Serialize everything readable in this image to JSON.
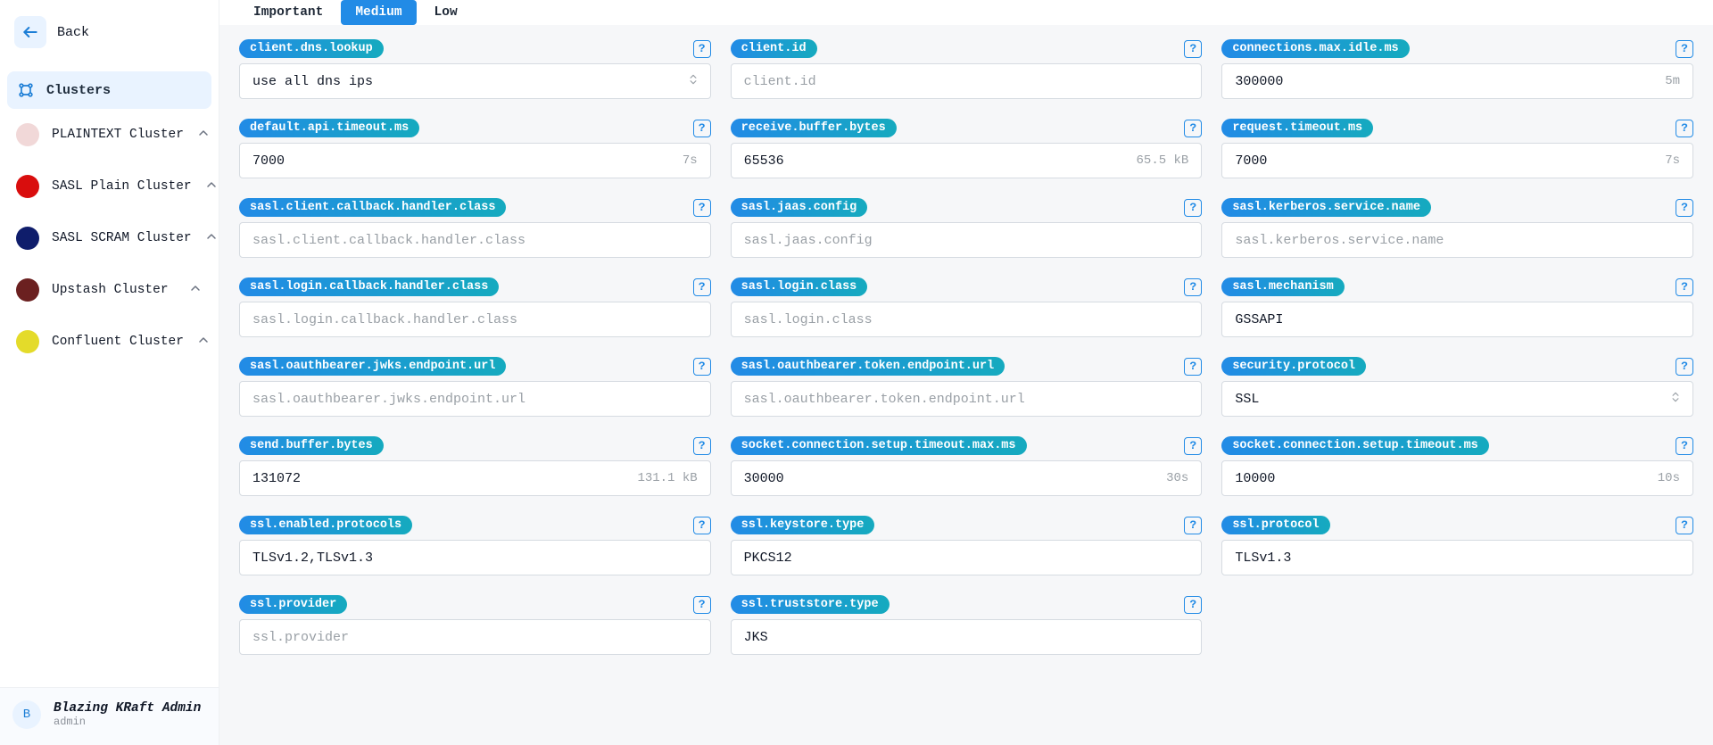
{
  "sidebar": {
    "back_label": "Back",
    "nav_section_label": "Clusters",
    "clusters": [
      {
        "label": "PLAINTEXT Cluster",
        "color": "#f1d8d8"
      },
      {
        "label": "SASL Plain Cluster",
        "color": "#d90d0d"
      },
      {
        "label": "SASL SCRAM Cluster",
        "color": "#0f1d6b"
      },
      {
        "label": "Upstash Cluster",
        "color": "#6b2020"
      },
      {
        "label": "Confluent Cluster",
        "color": "#e4db2a"
      }
    ],
    "footer": {
      "avatar_letter": "B",
      "user_name": "Blazing KRaft Admin",
      "user_role": "admin"
    }
  },
  "tabs": [
    {
      "label": "Important",
      "active": false
    },
    {
      "label": "Medium",
      "active": true
    },
    {
      "label": "Low",
      "active": false
    }
  ],
  "help_glyph": "?",
  "fields": [
    {
      "key": "client.dns.lookup",
      "value": "use all dns ips",
      "placeholder": "",
      "suffix": "",
      "select": true,
      "help": true
    },
    {
      "key": "client.id",
      "value": "",
      "placeholder": "client.id",
      "suffix": "",
      "select": false,
      "help": true
    },
    {
      "key": "connections.max.idle.ms",
      "value": "300000",
      "placeholder": "",
      "suffix": "5m",
      "select": false,
      "help": true
    },
    {
      "key": "default.api.timeout.ms",
      "value": "7000",
      "placeholder": "",
      "suffix": "7s",
      "select": false,
      "help": true
    },
    {
      "key": "receive.buffer.bytes",
      "value": "65536",
      "placeholder": "",
      "suffix": "65.5 kB",
      "select": false,
      "help": true
    },
    {
      "key": "request.timeout.ms",
      "value": "7000",
      "placeholder": "",
      "suffix": "7s",
      "select": false,
      "help": true
    },
    {
      "key": "sasl.client.callback.handler.class",
      "value": "",
      "placeholder": "sasl.client.callback.handler.class",
      "suffix": "",
      "select": false,
      "help": true
    },
    {
      "key": "sasl.jaas.config",
      "value": "",
      "placeholder": "sasl.jaas.config",
      "suffix": "",
      "select": false,
      "help": true
    },
    {
      "key": "sasl.kerberos.service.name",
      "value": "",
      "placeholder": "sasl.kerberos.service.name",
      "suffix": "",
      "select": false,
      "help": true
    },
    {
      "key": "sasl.login.callback.handler.class",
      "value": "",
      "placeholder": "sasl.login.callback.handler.class",
      "suffix": "",
      "select": false,
      "help": true
    },
    {
      "key": "sasl.login.class",
      "value": "",
      "placeholder": "sasl.login.class",
      "suffix": "",
      "select": false,
      "help": true
    },
    {
      "key": "sasl.mechanism",
      "value": "GSSAPI",
      "placeholder": "",
      "suffix": "",
      "select": false,
      "help": true
    },
    {
      "key": "sasl.oauthbearer.jwks.endpoint.url",
      "value": "",
      "placeholder": "sasl.oauthbearer.jwks.endpoint.url",
      "suffix": "",
      "select": false,
      "help": true
    },
    {
      "key": "sasl.oauthbearer.token.endpoint.url",
      "value": "",
      "placeholder": "sasl.oauthbearer.token.endpoint.url",
      "suffix": "",
      "select": false,
      "help": true
    },
    {
      "key": "security.protocol",
      "value": "SSL",
      "placeholder": "",
      "suffix": "",
      "select": true,
      "help": true
    },
    {
      "key": "send.buffer.bytes",
      "value": "131072",
      "placeholder": "",
      "suffix": "131.1 kB",
      "select": false,
      "help": true
    },
    {
      "key": "socket.connection.setup.timeout.max.ms",
      "value": "30000",
      "placeholder": "",
      "suffix": "30s",
      "select": false,
      "help": true
    },
    {
      "key": "socket.connection.setup.timeout.ms",
      "value": "10000",
      "placeholder": "",
      "suffix": "10s",
      "select": false,
      "help": true
    },
    {
      "key": "ssl.enabled.protocols",
      "value": "TLSv1.2,TLSv1.3",
      "placeholder": "",
      "suffix": "",
      "select": false,
      "help": true
    },
    {
      "key": "ssl.keystore.type",
      "value": "PKCS12",
      "placeholder": "",
      "suffix": "",
      "select": false,
      "help": true
    },
    {
      "key": "ssl.protocol",
      "value": "TLSv1.3",
      "placeholder": "",
      "suffix": "",
      "select": false,
      "help": true
    },
    {
      "key": "ssl.provider",
      "value": "",
      "placeholder": "ssl.provider",
      "suffix": "",
      "select": false,
      "help": true
    },
    {
      "key": "ssl.truststore.type",
      "value": "JKS",
      "placeholder": "",
      "suffix": "",
      "select": false,
      "help": true
    }
  ]
}
